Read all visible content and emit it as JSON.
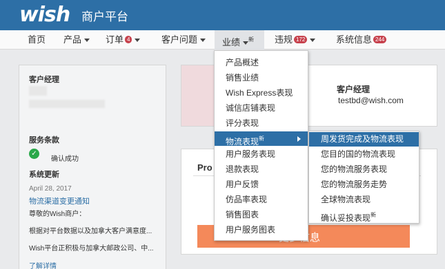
{
  "header": {
    "logo": "wish",
    "portal_title": "商户平台"
  },
  "nav": {
    "home": "首页",
    "products": "产品",
    "orders": "订单",
    "orders_badge": "4",
    "customer_issues": "客户问题",
    "performance": "业绩",
    "performance_new": "新",
    "violations": "违规",
    "violations_badge": "172",
    "system_info": "系统信息",
    "system_info_badge": "244"
  },
  "left_panel": {
    "manager_title": "客户经理",
    "terms_title": "服务条款",
    "terms_status": "确认成功",
    "updates_title": "系统更新",
    "update_date": "April 28, 2017",
    "update_title": "物流渠道变更通知",
    "greeting": "尊敬的Wish商户：",
    "line1": "根据对平台数据以及加拿大客户满意度...",
    "line2": "Wish平台正积极与加拿大邮政公司、中...",
    "more_link": "了解详情"
  },
  "cards": {
    "manager_title": "客户经理",
    "manager_email": "testbd@wish.com",
    "pro_label": "Pro",
    "button_label": "更多信息"
  },
  "menu": {
    "items": [
      {
        "label": "产品概述"
      },
      {
        "label": "销售业绩"
      },
      {
        "label": "Wish Express表现"
      },
      {
        "label": "诚信店铺表现"
      },
      {
        "label": "评分表现"
      },
      {
        "label": "物流表现",
        "new": "新"
      },
      {
        "label": "用户服务表现"
      },
      {
        "label": "退款表现"
      },
      {
        "label": "用户反馈"
      },
      {
        "label": "仿品率表现"
      },
      {
        "label": "销售图表"
      },
      {
        "label": "用户服务图表"
      }
    ]
  },
  "submenu": {
    "items": [
      {
        "label": "周发货完成及物流表现"
      },
      {
        "label": "您目的国的物流表现"
      },
      {
        "label": "您的物流服务表现"
      },
      {
        "label": "您的物流服务走势"
      },
      {
        "label": "全球物流表现"
      },
      {
        "label": "确认妥投表现",
        "new": "新"
      }
    ]
  },
  "colors": {
    "header_bg": "#2d6fa6",
    "highlight": "#2d6fa6",
    "badge": "#c7424d",
    "button": "#f4895a"
  }
}
